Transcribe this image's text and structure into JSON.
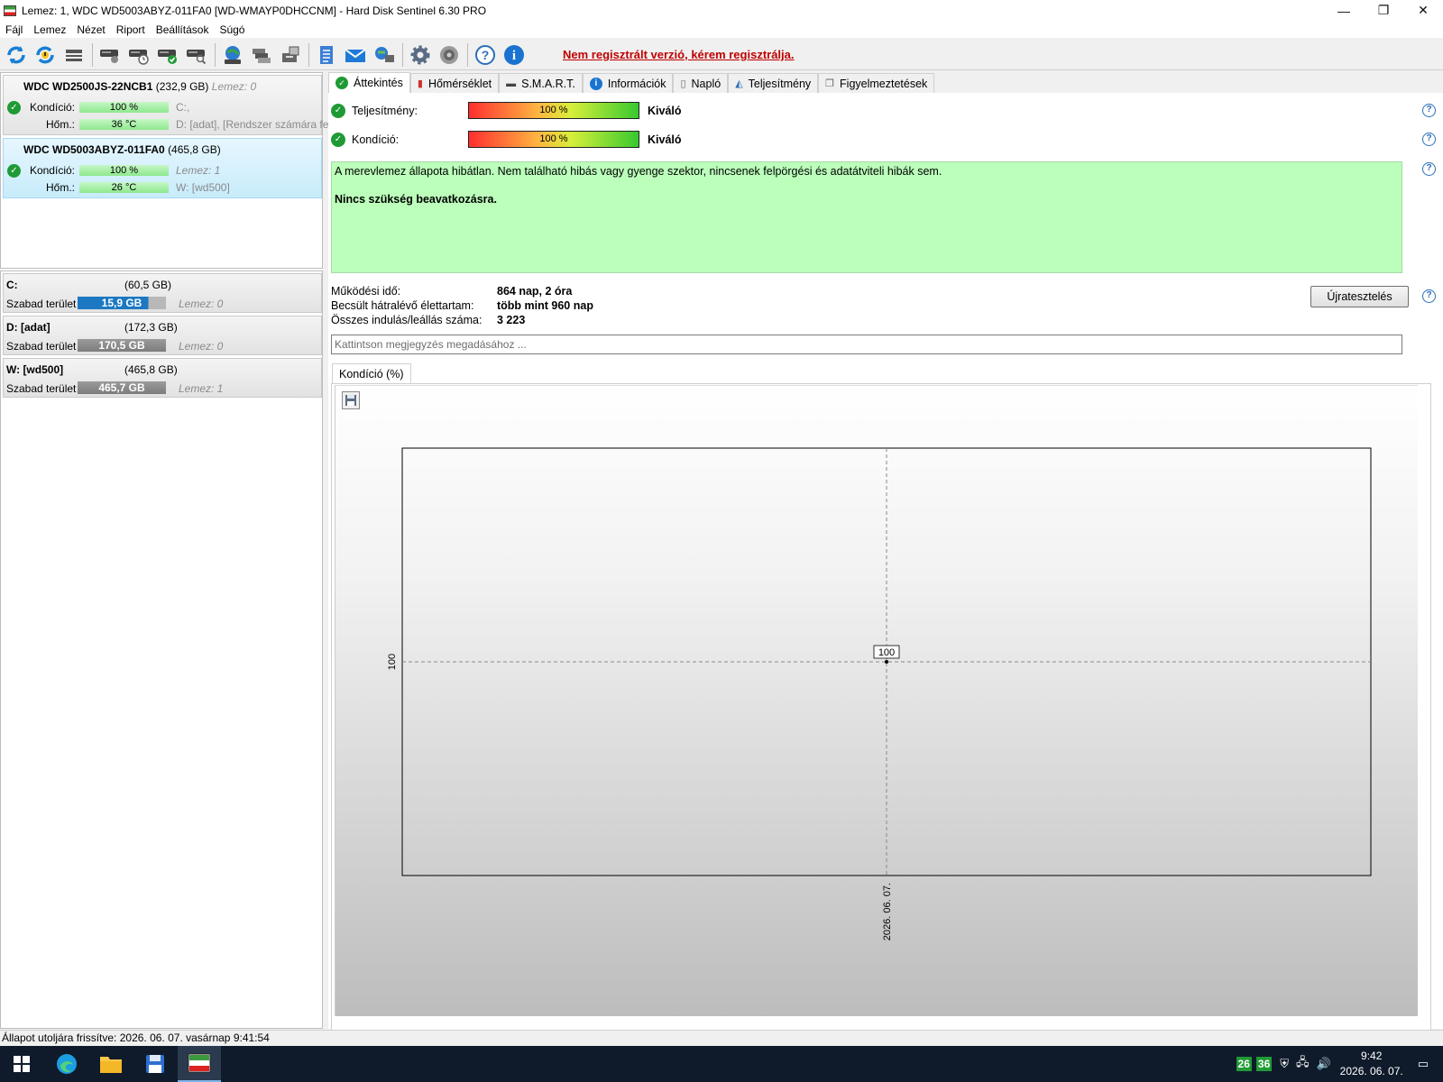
{
  "window": {
    "title": "Lemez: 1, WDC WD5003ABYZ-011FA0 [WD-WMAYP0DHCCNM]  -  Hard Disk Sentinel 6.30 PRO",
    "minimize": "—",
    "maximize": "❐",
    "close": "✕"
  },
  "menu": [
    "Fájl",
    "Lemez",
    "Nézet",
    "Riport",
    "Beállítások",
    "Súgó"
  ],
  "toolbar": {
    "register_text": "Nem regisztrált verzió, kérem regisztrálja."
  },
  "disks": [
    {
      "name": "WDC WD2500JS-22NCB1",
      "size": "(232,9 GB)",
      "disk_label": "Lemez: 0",
      "health_label": "Kondíció:",
      "health": "100 %",
      "health_aux": "C:,",
      "temp_label": "Hőm.:",
      "temp": "36 °C",
      "temp_aux": "D: [adat],  [Rendszer számára fe"
    },
    {
      "name": "WDC WD5003ABYZ-011FA0",
      "size": "(465,8 GB)",
      "disk_label": "",
      "health_label": "Kondíció:",
      "health": "100 %",
      "health_aux": "Lemez: 1",
      "temp_label": "Hőm.:",
      "temp": "26 °C",
      "temp_aux": "W: [wd500]"
    }
  ],
  "volumes": [
    {
      "name": "C:",
      "size": "(60,5 GB)",
      "free_label": "Szabad terület",
      "free": "15,9 GB",
      "disk": "Lemez: 0"
    },
    {
      "name": "D: [adat]",
      "size": "(172,3 GB)",
      "free_label": "Szabad terület",
      "free": "170,5 GB",
      "disk": "Lemez: 0"
    },
    {
      "name": "W: [wd500]",
      "size": "(465,8 GB)",
      "free_label": "Szabad terület",
      "free": "465,7 GB",
      "disk": "Lemez: 1"
    }
  ],
  "tabs": [
    "Áttekintés",
    "Hőmérséklet",
    "S.M.A.R.T.",
    "Információk",
    "Napló",
    "Teljesítmény",
    "Figyelmeztetések"
  ],
  "overview": {
    "performance_label": "Teljesítmény:",
    "performance_value": "100 %",
    "performance_rating": "Kiváló",
    "performance_fraction": 1.0,
    "health_label": "Kondíció:",
    "health_value": "100 %",
    "health_rating": "Kiváló",
    "health_fraction": 1.0,
    "status_text": "A merevlemez állapota hibátlan. Nem található hibás vagy gyenge szektor, nincsenek felpörgési és adatátviteli hibák sem.",
    "action_text": "Nincs szükség beavatkozásra.",
    "uptime_label": "Működési idő:",
    "uptime": "864 nap, 2 óra",
    "remaining_label": "Becsült hátralévő élettartam:",
    "remaining": "több mint 960 nap",
    "starts_label": "Összes indulás/leállás száma:",
    "starts": "3 223",
    "retest_button": "Újratesztelés",
    "note_placeholder": "Kattintson megjegyzés megadásához ..."
  },
  "graph_tab": "Kondíció  (%)",
  "chart_data": {
    "type": "line",
    "x": [
      "2026. 06. 07."
    ],
    "series": [
      {
        "values": [
          100
        ]
      }
    ],
    "yticks": [
      100
    ],
    "point_labels": [
      "100"
    ],
    "grid": true
  },
  "statusbar": "Állapot utoljára frissítve: 2026. 06. 07. vasárnap 9:41:54",
  "taskbar": {
    "tray_temp1": "26",
    "tray_temp2": "36",
    "time": "9:42",
    "date": "2026. 06. 07."
  }
}
